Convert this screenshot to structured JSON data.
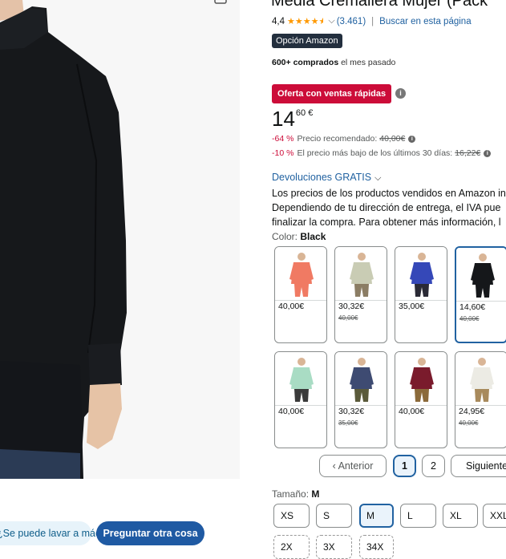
{
  "product": {
    "title": "Media Cremallera Mujer (Pack",
    "rating": "4,4",
    "rating_count": "(3.461)",
    "search_link": "Buscar en esta página",
    "badge": "Opción Amazon",
    "bought_bold": "600+ comprados",
    "bought_rest": "el mes pasado",
    "deal_label": "Oferta con ventas rápidas",
    "price_whole": "14",
    "price_fraction": "60 €",
    "disc1_pct": "-64 %",
    "disc1_label": "Precio recomendado:",
    "disc1_old": "40,00€",
    "disc2_pct": "-10 %",
    "disc2_label": "El precio más bajo de los últimos 30 días:",
    "disc2_old": "16,22€",
    "returns": "Devoluciones GRATIS",
    "info_lines": [
      "Los precios de los productos vendidos en Amazon in",
      "Dependiendo de tu dirección de entrega, el IVA pue",
      "finalizar la compra. Para obtener más información, l"
    ],
    "color_label": "Color:",
    "color_value": "Black",
    "size_label": "Tamaño:",
    "size_value": "M"
  },
  "swatches": [
    {
      "price": "40,00€",
      "old": "",
      "color": "#f07a63",
      "pants": "#f07a63",
      "selected": false
    },
    {
      "price": "30,32€",
      "old": "40,00€",
      "color": "#c9ccb4",
      "pants": "#8b7d64",
      "selected": false
    },
    {
      "price": "35,00€",
      "old": "",
      "color": "#3548b8",
      "pants": "#2a2a35",
      "selected": false
    },
    {
      "price": "14,60€",
      "old": "40,00€",
      "color": "#15171a",
      "pants": "#15171a",
      "selected": true
    },
    {
      "price": "40,00€",
      "old": "",
      "color": "#a9dcc4",
      "pants": "#3a3a3a",
      "selected": false
    },
    {
      "price": "30,32€",
      "old": "35,00€",
      "color": "#3e4b72",
      "pants": "#5a5a3a",
      "selected": false
    },
    {
      "price": "40,00€",
      "old": "",
      "color": "#7a1b2c",
      "pants": "#8b6a3a",
      "selected": false
    },
    {
      "price": "24,95€",
      "old": "40,00€",
      "color": "#ecebe4",
      "pants": "#a88a5c",
      "selected": false
    }
  ],
  "pagination": {
    "prev": "‹ Anterior",
    "pages": [
      "1",
      "2"
    ],
    "next": "Siguiente"
  },
  "sizes": [
    "XS",
    "S",
    "M",
    "L",
    "XL",
    "XXL",
    "2X",
    "3X",
    "34X"
  ],
  "chips": {
    "question": "¿Se puede lavar a máquina?",
    "ask": "Preguntar otra cosa"
  },
  "colors": {
    "link": "#2162a1",
    "deal": "#cc0c39",
    "star": "#ff9900",
    "badge_bg": "#232f3e",
    "ask_bg": "#1f5aa3"
  }
}
